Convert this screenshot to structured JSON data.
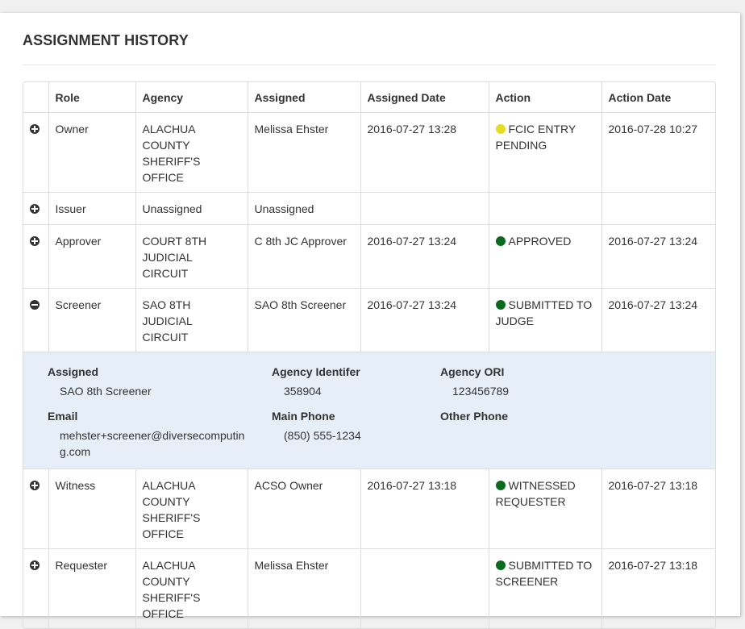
{
  "section": {
    "title": "ASSIGNMENT HISTORY"
  },
  "table": {
    "headers": [
      "",
      "Role",
      "Agency",
      "Assigned",
      "Assigned Date",
      "Action",
      "Action Date"
    ],
    "rows": [
      {
        "toggle": "plus",
        "role": "Owner",
        "agency": "ALACHUA COUNTY SHERIFF'S OFFICE",
        "assigned": "Melissa Ehster",
        "assigned_date": "2016-07-27 13:28",
        "action": "FCIC ENTRY PENDING",
        "action_color": "#e8dc1e",
        "action_date": "2016-07-28 10:27"
      },
      {
        "toggle": "plus",
        "role": "Issuer",
        "agency": "Unassigned",
        "assigned": "Unassigned",
        "assigned_date": "",
        "action": "",
        "action_color": "",
        "action_date": ""
      },
      {
        "toggle": "plus",
        "role": "Approver",
        "agency": "COURT 8TH JUDICIAL CIRCUIT",
        "assigned": "C 8th JC Approver",
        "assigned_date": "2016-07-27 13:24",
        "action": "APPROVED",
        "action_color": "#0a6b1e",
        "action_date": "2016-07-27 13:24"
      },
      {
        "toggle": "minus",
        "role": "Screener",
        "agency": "SAO 8TH JUDICIAL CIRCUIT",
        "assigned": "SAO 8th Screener",
        "assigned_date": "2016-07-27 13:24",
        "action": "SUBMITTED TO JUDGE",
        "action_color": "#0a6b1e",
        "action_date": "2016-07-27 13:24"
      },
      {
        "toggle": "plus",
        "role": "Witness",
        "agency": "ALACHUA COUNTY SHERIFF'S OFFICE",
        "assigned": "ACSO Owner",
        "assigned_date": "2016-07-27 13:18",
        "action": "WITNESSED REQUESTER",
        "action_color": "#0a6b1e",
        "action_date": "2016-07-27 13:18"
      },
      {
        "toggle": "plus",
        "role": "Requester",
        "agency": "ALACHUA COUNTY SHERIFF'S OFFICE",
        "assigned": "Melissa Ehster",
        "assigned_date": "",
        "action": "SUBMITTED TO SCREENER",
        "action_color": "#0a6b1e",
        "action_date": "2016-07-27 13:18"
      }
    ]
  },
  "detail": {
    "assigned_label": "Assigned",
    "assigned_value": "SAO 8th Screener",
    "agency_identifier_label": "Agency Identifer",
    "agency_identifier_value": "358904",
    "agency_ori_label": "Agency ORI",
    "agency_ori_value": "123456789",
    "email_label": "Email",
    "email_value": "mehster+screener@diversecomputing.com",
    "main_phone_label": "Main Phone",
    "main_phone_value": "(850) 555-1234",
    "other_phone_label": "Other Phone",
    "other_phone_value": ""
  }
}
